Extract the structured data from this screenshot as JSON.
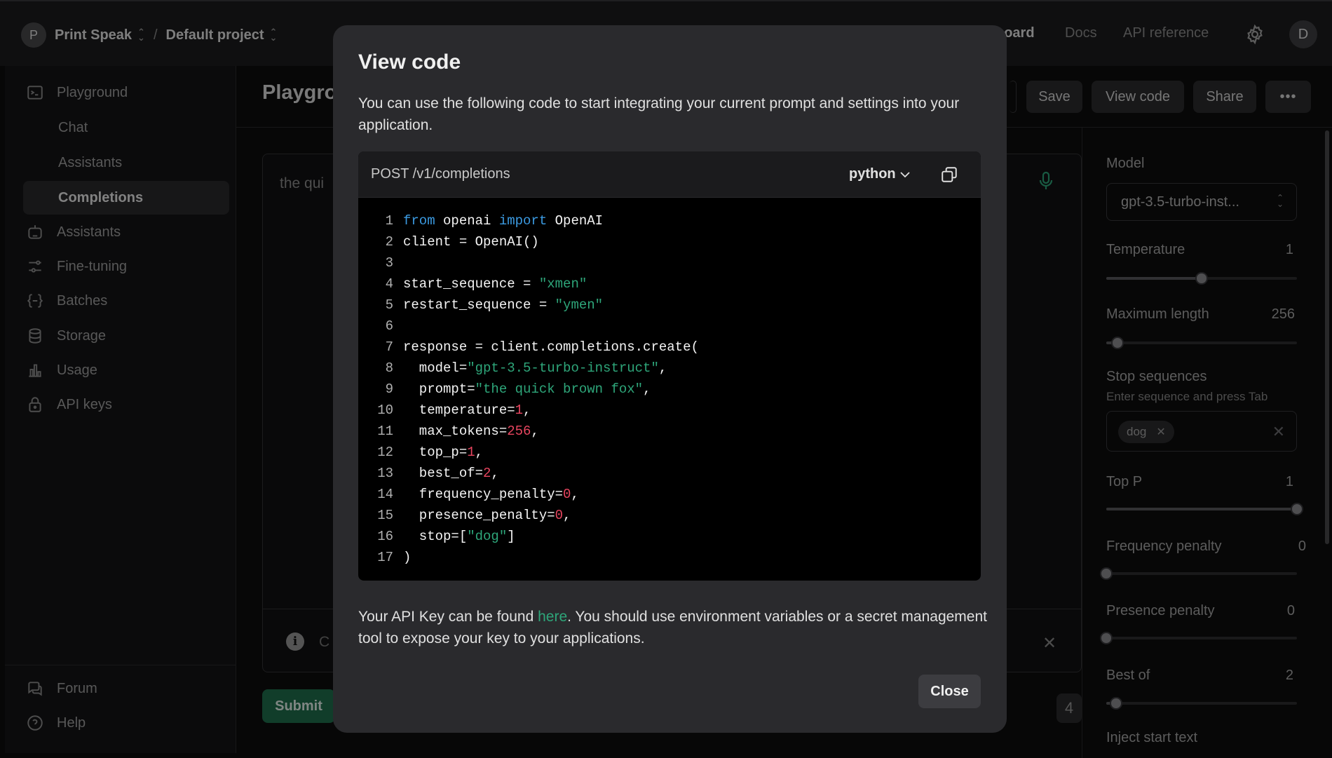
{
  "topbar": {
    "org_initial": "P",
    "org_name": "Print Speak",
    "separator": "/",
    "project_name": "Default project",
    "nav": [
      "board",
      "Docs",
      "API reference"
    ],
    "user_initial": "D"
  },
  "sidebar": {
    "items": [
      {
        "label": "Playground",
        "icon": "terminal-icon"
      },
      {
        "label": "Chat"
      },
      {
        "label": "Assistants"
      },
      {
        "label": "Completions"
      },
      {
        "label": "Assistants",
        "icon": "robot-icon"
      },
      {
        "label": "Fine-tuning",
        "icon": "sliders-icon"
      },
      {
        "label": "Batches",
        "icon": "braces-icon"
      },
      {
        "label": "Storage",
        "icon": "database-icon"
      },
      {
        "label": "Usage",
        "icon": "bar-chart-icon"
      },
      {
        "label": "API keys",
        "icon": "lock-icon"
      }
    ],
    "footer": [
      {
        "label": "Forum",
        "icon": "chat-bubbles-icon"
      },
      {
        "label": "Help",
        "icon": "help-circle-icon"
      }
    ]
  },
  "main": {
    "title_partial": "Playgro",
    "header_buttons": {
      "save": "Save",
      "view_code": "View code",
      "share": "Share",
      "more": "•••"
    },
    "prompt_partial": "the qui",
    "info_partial": "C",
    "submit": "Submit",
    "token_partial": "4"
  },
  "settings": {
    "model_label": "Model",
    "model_value": "gpt-3.5-turbo-inst...",
    "temperature": {
      "label": "Temperature",
      "value": "1",
      "fraction": 0.5
    },
    "max_length": {
      "label": "Maximum length",
      "value": "256",
      "fraction": 0.06
    },
    "stop": {
      "label": "Stop sequences",
      "hint": "Enter sequence and press Tab",
      "chip": "dog"
    },
    "top_p": {
      "label": "Top P",
      "value": "1",
      "fraction": 1.0
    },
    "frequency_penalty": {
      "label": "Frequency penalty",
      "value": "0",
      "fraction": 0.0
    },
    "presence_penalty": {
      "label": "Presence penalty",
      "value": "0",
      "fraction": 0.0
    },
    "best_of": {
      "label": "Best of",
      "value": "2",
      "fraction": 0.05
    },
    "inject_start": {
      "label": "Inject start text"
    }
  },
  "modal": {
    "title": "View code",
    "description": "You can use the following code to start integrating your current prompt and settings into your application.",
    "endpoint": "POST /v1/completions",
    "language": "python",
    "code_lines": [
      [
        [
          "kw",
          "from"
        ],
        [
          "t",
          " openai "
        ],
        [
          "kw",
          "import"
        ],
        [
          "t",
          " OpenAI"
        ]
      ],
      [
        [
          "t",
          "client = OpenAI()"
        ]
      ],
      [],
      [
        [
          "t",
          "start_sequence = "
        ],
        [
          "str",
          "\"xmen\""
        ]
      ],
      [
        [
          "t",
          "restart_sequence = "
        ],
        [
          "str",
          "\"ymen\""
        ]
      ],
      [],
      [
        [
          "t",
          "response = client.completions.create("
        ]
      ],
      [
        [
          "t",
          "  model="
        ],
        [
          "str",
          "\"gpt-3.5-turbo-instruct\""
        ],
        [
          "t",
          ","
        ]
      ],
      [
        [
          "t",
          "  prompt="
        ],
        [
          "str",
          "\"the quick brown fox\""
        ],
        [
          "t",
          ","
        ]
      ],
      [
        [
          "t",
          "  temperature="
        ],
        [
          "num",
          "1"
        ],
        [
          "t",
          ","
        ]
      ],
      [
        [
          "t",
          "  max_tokens="
        ],
        [
          "num",
          "256"
        ],
        [
          "t",
          ","
        ]
      ],
      [
        [
          "t",
          "  top_p="
        ],
        [
          "num",
          "1"
        ],
        [
          "t",
          ","
        ]
      ],
      [
        [
          "t",
          "  best_of="
        ],
        [
          "num",
          "2"
        ],
        [
          "t",
          ","
        ]
      ],
      [
        [
          "t",
          "  frequency_penalty="
        ],
        [
          "num",
          "0"
        ],
        [
          "t",
          ","
        ]
      ],
      [
        [
          "t",
          "  presence_penalty="
        ],
        [
          "num",
          "0"
        ],
        [
          "t",
          ","
        ]
      ],
      [
        [
          "t",
          "  stop=["
        ],
        [
          "str",
          "\"dog\""
        ],
        [
          "t",
          "]"
        ]
      ],
      [
        [
          "t",
          ")"
        ]
      ]
    ],
    "note_before": "Your API Key can be found ",
    "note_link": "here",
    "note_after": ". You should use environment variables or a secret management tool to expose your key to your applications.",
    "close": "Close"
  },
  "colors": {
    "accent_green": "#2ea67a",
    "keyword_blue": "#3b9ae1",
    "number_red": "#e8455f",
    "submit_green": "#1f6f4e"
  }
}
